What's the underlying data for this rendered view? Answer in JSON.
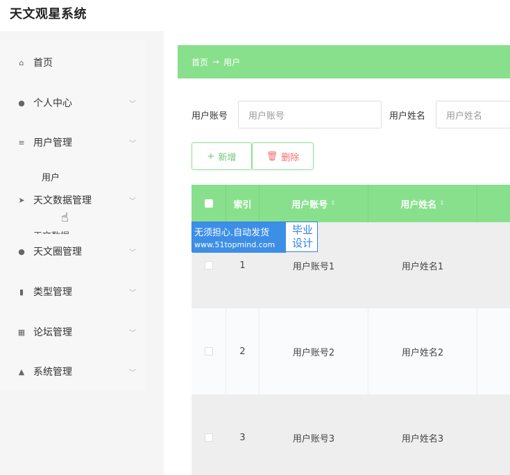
{
  "app": {
    "title": "天文观星系统"
  },
  "sidebar": {
    "items": [
      {
        "label": "首页",
        "icon": "home-icon",
        "glyph": "⌂"
      },
      {
        "label": "个人中心",
        "icon": "user-icon",
        "glyph": "●",
        "chevron": "﹀"
      },
      {
        "label": "用户管理",
        "icon": "sliders-icon",
        "glyph": "≡",
        "chevron": "﹀"
      },
      {
        "label": "天文数据管理",
        "icon": "send-icon",
        "glyph": "➤",
        "chevron": "﹀"
      },
      {
        "label": "天文圈管理",
        "icon": "user-badge-icon",
        "glyph": "●",
        "chevron": "﹀"
      },
      {
        "label": "类型管理",
        "icon": "chart-icon",
        "glyph": "▮",
        "chevron": "﹀"
      },
      {
        "label": "论坛管理",
        "icon": "grid-icon",
        "glyph": "▦",
        "chevron": "﹀"
      },
      {
        "label": "系统管理",
        "icon": "settings-icon",
        "glyph": "▲",
        "chevron": "﹀"
      }
    ],
    "sub_user": "用户",
    "sub_data_partial": "天文数据"
  },
  "breadcrumb": {
    "home": "首页",
    "arrow": "→",
    "current": "用户"
  },
  "search": {
    "account_label": "用户账号",
    "account_placeholder": "用户账号",
    "name_label": "用户姓名",
    "name_placeholder": "用户姓名"
  },
  "buttons": {
    "add": "新增",
    "add_icon": "+",
    "delete": "删除",
    "delete_icon": "🗑"
  },
  "table": {
    "headers": {
      "index": "索引",
      "account": "用户账号",
      "name": "用户姓名",
      "sort_glyph": "⇕"
    },
    "rows": [
      {
        "index": "1",
        "account": "用户账号1",
        "name": "用户姓名1"
      },
      {
        "index": "2",
        "account": "用户账号2",
        "name": "用户姓名2"
      },
      {
        "index": "3",
        "account": "用户账号3",
        "name": "用户姓名3"
      }
    ]
  },
  "watermark": {
    "line1": "无须担心.自动发货",
    "line2": "www.51topmind.com",
    "right1": "毕业",
    "right2": "设计"
  },
  "colors": {
    "accent": "#88e08c",
    "danger": "#f56c6c",
    "watermark_blue": "#3d8fe6"
  }
}
